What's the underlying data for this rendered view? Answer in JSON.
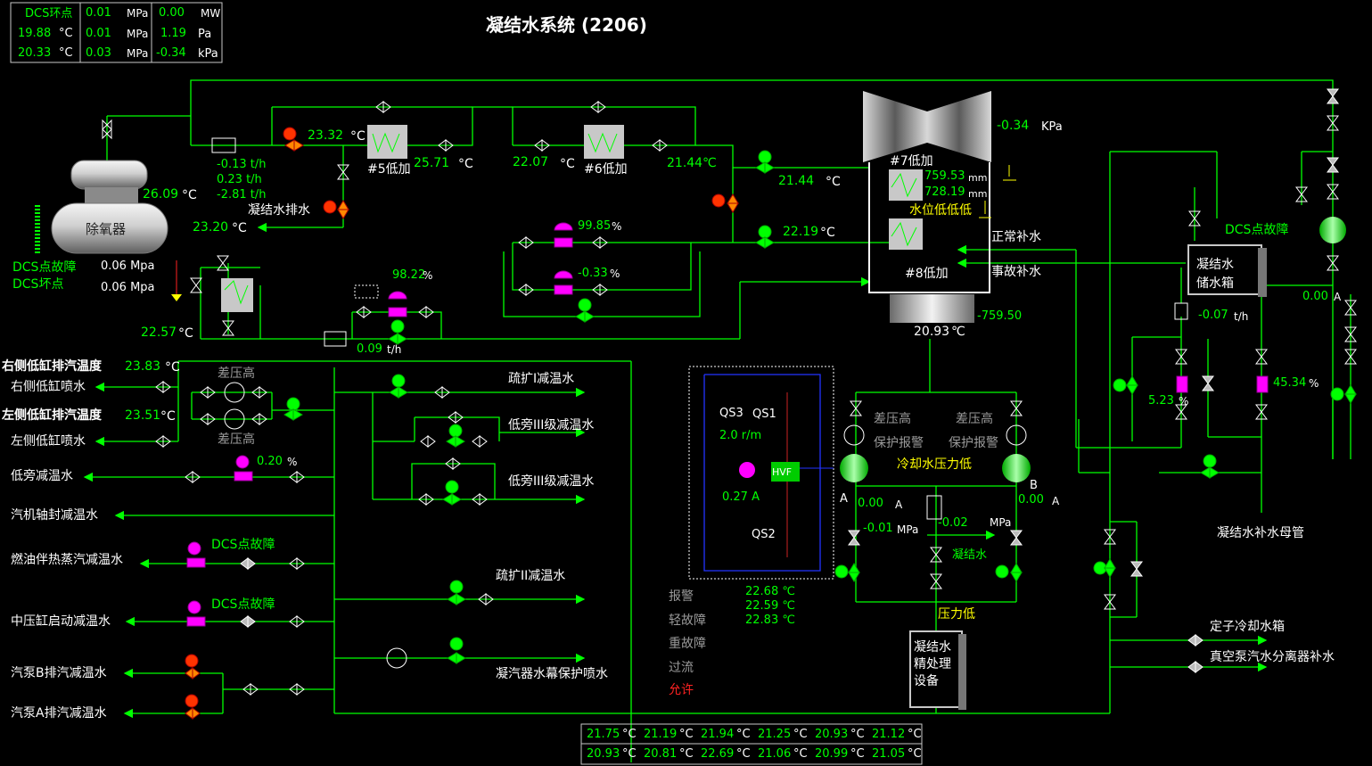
{
  "title": "凝结水系统 (2206)",
  "top_box": {
    "r1": [
      "DCS环点",
      "0.01",
      "MPa",
      "0.00",
      "MW"
    ],
    "r2": [
      "19.88",
      "°C",
      "0.01",
      "MPa",
      "1.19",
      "Pa"
    ],
    "r3": [
      "20.33",
      "°C",
      "0.03",
      "MPa",
      "-0.34",
      "kPa"
    ]
  },
  "deaerator": {
    "label": "除氧器",
    "temp": "26.09",
    "temp_unit": "°C",
    "fault1": "DCS点故障",
    "fault2": "DCS坏点",
    "p1": "0.06 Mpa",
    "p2": "0.06 Mpa"
  },
  "flows": {
    "f1": "-0.13 t/h",
    "f2": "0.23 t/h",
    "f3": "-2.81 t/h"
  },
  "heaters": {
    "h5": "#5低加",
    "h6": "#6低加",
    "h7": "#7低加",
    "h8": "#8低加",
    "v_23_32": "23.32",
    "v_25_71": "25.71",
    "v_22_07": "22.07",
    "v_21_44a": "21.44",
    "v_21_44b": "21.44",
    "v_22_19": "22.19",
    "v_23_20": "23.20",
    "v_22_57": "22.57",
    "degc": "°C",
    "degc2": "℃"
  },
  "condenser": {
    "kpa_val": "-0.34",
    "kpa_unit": "KPa",
    "lvl1": "759.53",
    "lvl2": "728.19",
    "mm": "mm",
    "low_alarm": "水位低低低",
    "normal_makeup": "正常补水",
    "emergency_makeup": "事故补水",
    "hotwell_val": "-759.50",
    "hotwell_temp": "20.93",
    "hotwell_unit": "℃"
  },
  "drain": {
    "label": "凝结水排水"
  },
  "valves": {
    "v99": "99.85",
    "v033": "-0.33",
    "v98": "98.22",
    "pct": "%",
    "flow009": "0.09",
    "tph": "t/h"
  },
  "left": {
    "right_exh_label": "右侧低缸排汽温度",
    "right_exh_val": "23.83",
    "right_exh_unit": "°C",
    "right_spray": "右侧低缸喷水",
    "left_exh_label": "左侧低缸排汽温度",
    "left_exh_val": "23.51",
    "left_exh_unit": "°C",
    "left_spray": "左侧低缸喷水",
    "dp_high1": "差压高",
    "dp_high2": "差压高",
    "low_bypass": "低旁减温水",
    "v020": "0.20",
    "pct": "%",
    "seal": "汽机轴封减温水",
    "oil": "燃油伴热蒸汽减温水",
    "dcs_fault_a": "DCS点故障",
    "ip": "中压缸启动减温水",
    "dcs_fault_b": "DCS点故障",
    "pumpB": "汽泵B排汽减温水",
    "pumpA": "汽泵A排汽减温水"
  },
  "mid": {
    "sk1": "疏扩I减温水",
    "lp3a": "低旁III级减温水",
    "lp3b": "低旁III级减温水",
    "sk2": "疏扩II减温水",
    "curtain": "凝汽器水幕保护喷水"
  },
  "vfd": {
    "qs3": "QS3",
    "qs1": "QS1",
    "qs2": "QS2",
    "speed": "2.0 r/m",
    "cur": "0.27 A",
    "hvf": "HVF",
    "alarm": "报警",
    "light": "轻故障",
    "heavy": "重故障",
    "over": "过流",
    "allow": "允许",
    "t1": "22.68 ℃",
    "t2": "22.59 ℃",
    "t3": "22.83 ℃"
  },
  "pumps": {
    "dp_left": "差压高",
    "prot_left": "保护报警",
    "dp_right": "差压高",
    "prot_right": "保护报警",
    "cool_low": "冷却水压力低",
    "A": "A",
    "B": "B",
    "curA": "0.00",
    "curB": "0.00",
    "ampA": "A",
    "ampB": "A",
    "pA": "-0.01",
    "mpa": "MPa",
    "p002": "-0.02",
    "mpa2": "MPa",
    "condensate": "凝结水",
    "press_low": "压力低",
    "polish": "凝结水精处理设备"
  },
  "right": {
    "dcs_fault": "DCS点故障",
    "tank1": "凝结水",
    "tank2": "储水箱",
    "amp000": "0.00",
    "ampA": "A",
    "flow": "-0.07",
    "tph": "t/h",
    "v523": "5.23",
    "v4534": "45.34",
    "pct": "%",
    "header": "凝结水补水母管",
    "stator": "定子冷却水箱",
    "vacuum": "真空泵汽水分离器补水"
  },
  "bottom": {
    "row1": [
      "21.75",
      "°C",
      "21.19",
      "°C",
      "21.94",
      "°C",
      "21.25",
      "°C",
      "20.93",
      "°C",
      "21.12",
      "°C"
    ],
    "row2": [
      "20.93",
      "°C",
      "20.81",
      "°C",
      "22.69",
      "°C",
      "21.06",
      "°C",
      "20.99",
      "°C",
      "21.05",
      "°C"
    ]
  }
}
